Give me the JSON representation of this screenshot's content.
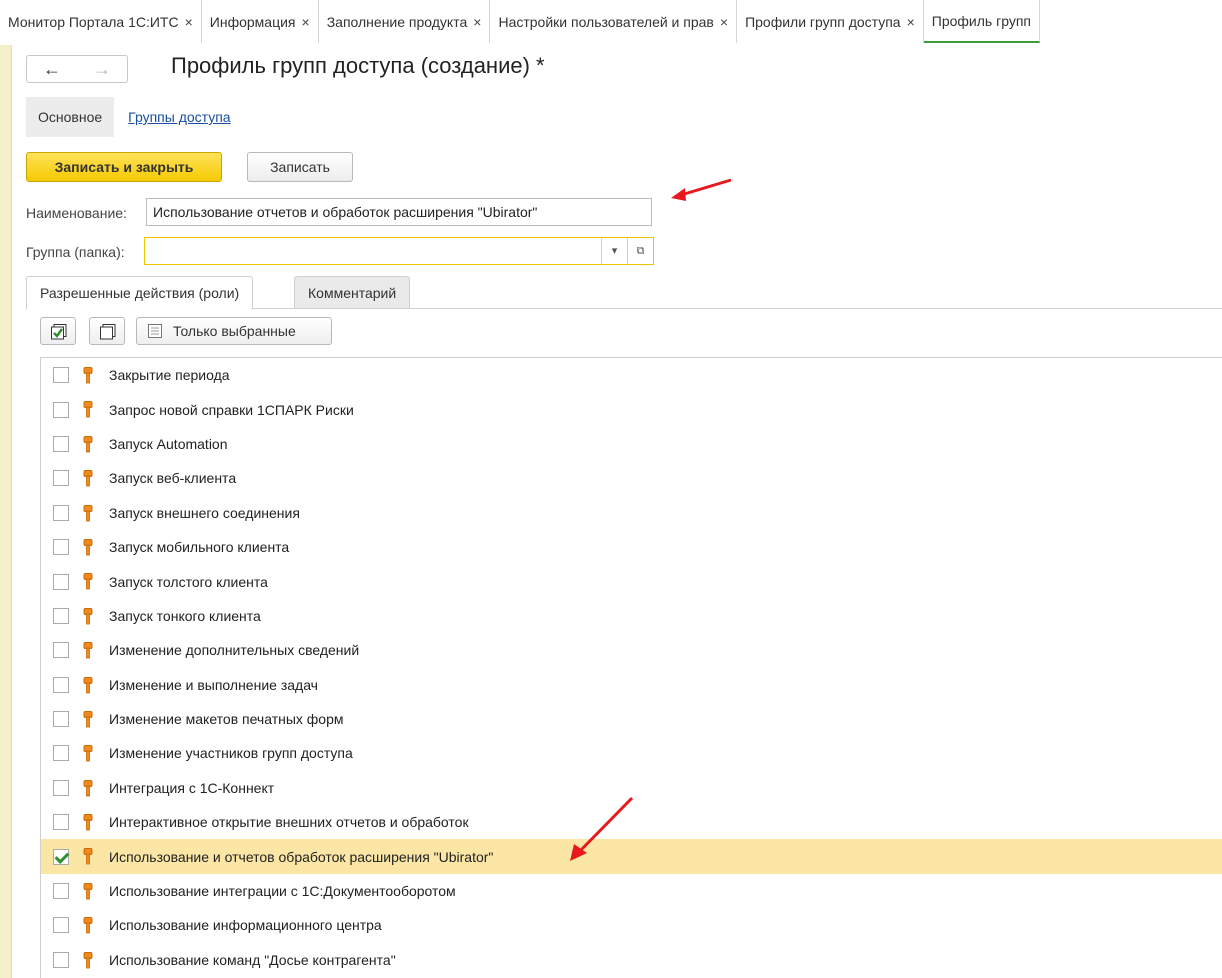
{
  "tabs": [
    {
      "label": "Монитор Портала 1С:ИТС",
      "close": "×"
    },
    {
      "label": "Информация",
      "close": "×"
    },
    {
      "label": "Заполнение продукта",
      "close": "×"
    },
    {
      "label": "Настройки пользователей и прав",
      "close": "×"
    },
    {
      "label": "Профили групп доступа",
      "close": "×"
    },
    {
      "label": "Профиль групп",
      "close": ""
    }
  ],
  "nav": {
    "back": "←",
    "forward": "→"
  },
  "form_title": "Профиль групп доступа (создание) *",
  "sections": {
    "main": "Основное",
    "link": "Группы доступа"
  },
  "buttons": {
    "save_close": "Записать и закрыть",
    "save": "Записать"
  },
  "fields": {
    "name_label": "Наименование:",
    "name_value": "Использование отчетов и обработок расширения \"Ubirator\"",
    "group_label": "Группа (папка):",
    "group_value": ""
  },
  "panel_tabs": {
    "roles": "Разрешенные действия (роли)",
    "comment": "Комментарий"
  },
  "toolbar": {
    "only_selected": "Только выбранные"
  },
  "roles": [
    {
      "label": "Закрытие периода",
      "checked": false
    },
    {
      "label": "Запрос новой справки 1СПАРК Риски",
      "checked": false
    },
    {
      "label": "Запуск Automation",
      "checked": false
    },
    {
      "label": "Запуск веб-клиента",
      "checked": false
    },
    {
      "label": "Запуск внешнего соединения",
      "checked": false
    },
    {
      "label": "Запуск мобильного клиента",
      "checked": false
    },
    {
      "label": "Запуск толстого клиента",
      "checked": false
    },
    {
      "label": "Запуск тонкого клиента",
      "checked": false
    },
    {
      "label": "Изменение дополнительных сведений",
      "checked": false
    },
    {
      "label": "Изменение и выполнение задач",
      "checked": false
    },
    {
      "label": "Изменение макетов печатных форм",
      "checked": false
    },
    {
      "label": "Изменение участников групп доступа",
      "checked": false
    },
    {
      "label": "Интеграция с 1С-Коннект",
      "checked": false
    },
    {
      "label": "Интерактивное открытие внешних отчетов и обработок",
      "checked": false
    },
    {
      "label": "Использование и отчетов обработок расширения \"Ubirator\"",
      "checked": true
    },
    {
      "label": "Использование интеграции с 1С:Документооборотом",
      "checked": false
    },
    {
      "label": "Использование информационного центра",
      "checked": false
    },
    {
      "label": "Использование команд \"Досье контрагента\"",
      "checked": false
    }
  ],
  "colors": {
    "accent_yellow": "#f6c900",
    "selected_row": "#fbe6a6",
    "annotation_arrow": "#e8191e",
    "active_tab": "#3e9b3e"
  }
}
